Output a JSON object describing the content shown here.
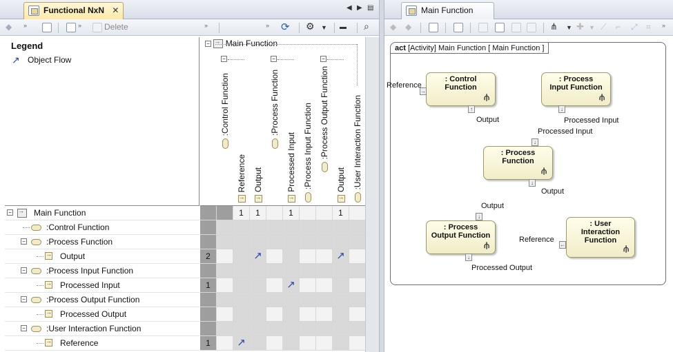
{
  "left_tab": {
    "title": "Functional NxN",
    "close": "✕"
  },
  "right_tab": {
    "title": "Main Function"
  },
  "left_toolbar": {
    "delete_label": "Delete"
  },
  "legend": {
    "title": "Legend",
    "item_label": "Object Flow",
    "item_icon": "object-flow-arrow-icon"
  },
  "columns": {
    "root_label": "Main Function",
    "items": [
      ":Control Function",
      "Reference",
      "Output",
      ":Process Function",
      "Processed Input",
      ":Process Input Function",
      ":Process Output Function",
      "Output",
      ":User Interaction Function"
    ]
  },
  "rows": [
    {
      "label": "Main Function",
      "kind": "root"
    },
    {
      "label": ":Control Function",
      "kind": "part"
    },
    {
      "label": ":Process Function",
      "kind": "part"
    },
    {
      "label": "Output",
      "kind": "pin"
    },
    {
      "label": ":Process Input Function",
      "kind": "part"
    },
    {
      "label": "Processed Input",
      "kind": "pin"
    },
    {
      "label": ":Process Output Function",
      "kind": "part"
    },
    {
      "label": "Processed Output",
      "kind": "pin"
    },
    {
      "label": ":User Interaction Function",
      "kind": "part"
    },
    {
      "label": "Reference",
      "kind": "pin"
    }
  ],
  "column_counts": [
    "",
    "1",
    "1",
    "",
    "1",
    "",
    "",
    "1",
    ""
  ],
  "row_counts": [
    "",
    "",
    "",
    "2",
    "",
    "1",
    "",
    "",
    "",
    "1"
  ],
  "flows": [
    {
      "row": 3,
      "col": 2
    },
    {
      "row": 3,
      "col": 7
    },
    {
      "row": 5,
      "col": 4
    },
    {
      "row": 9,
      "col": 1
    }
  ],
  "diagram": {
    "frame_kind": "act",
    "frame_label": "[Activity] Main Function [ Main Function ]",
    "nodes": [
      {
        "name": ": Control\nFunction"
      },
      {
        "name": ": Process\nInput Function"
      },
      {
        "name": ": Process\nFunction"
      },
      {
        "name": ": Process\nOutput Function"
      },
      {
        "name": ": User\nInteraction\nFunction"
      }
    ],
    "pin_labels": [
      "Reference",
      "Output",
      "Processed Input",
      "Processed Input",
      "Output",
      "Output",
      "Processed Output",
      "Reference"
    ]
  }
}
